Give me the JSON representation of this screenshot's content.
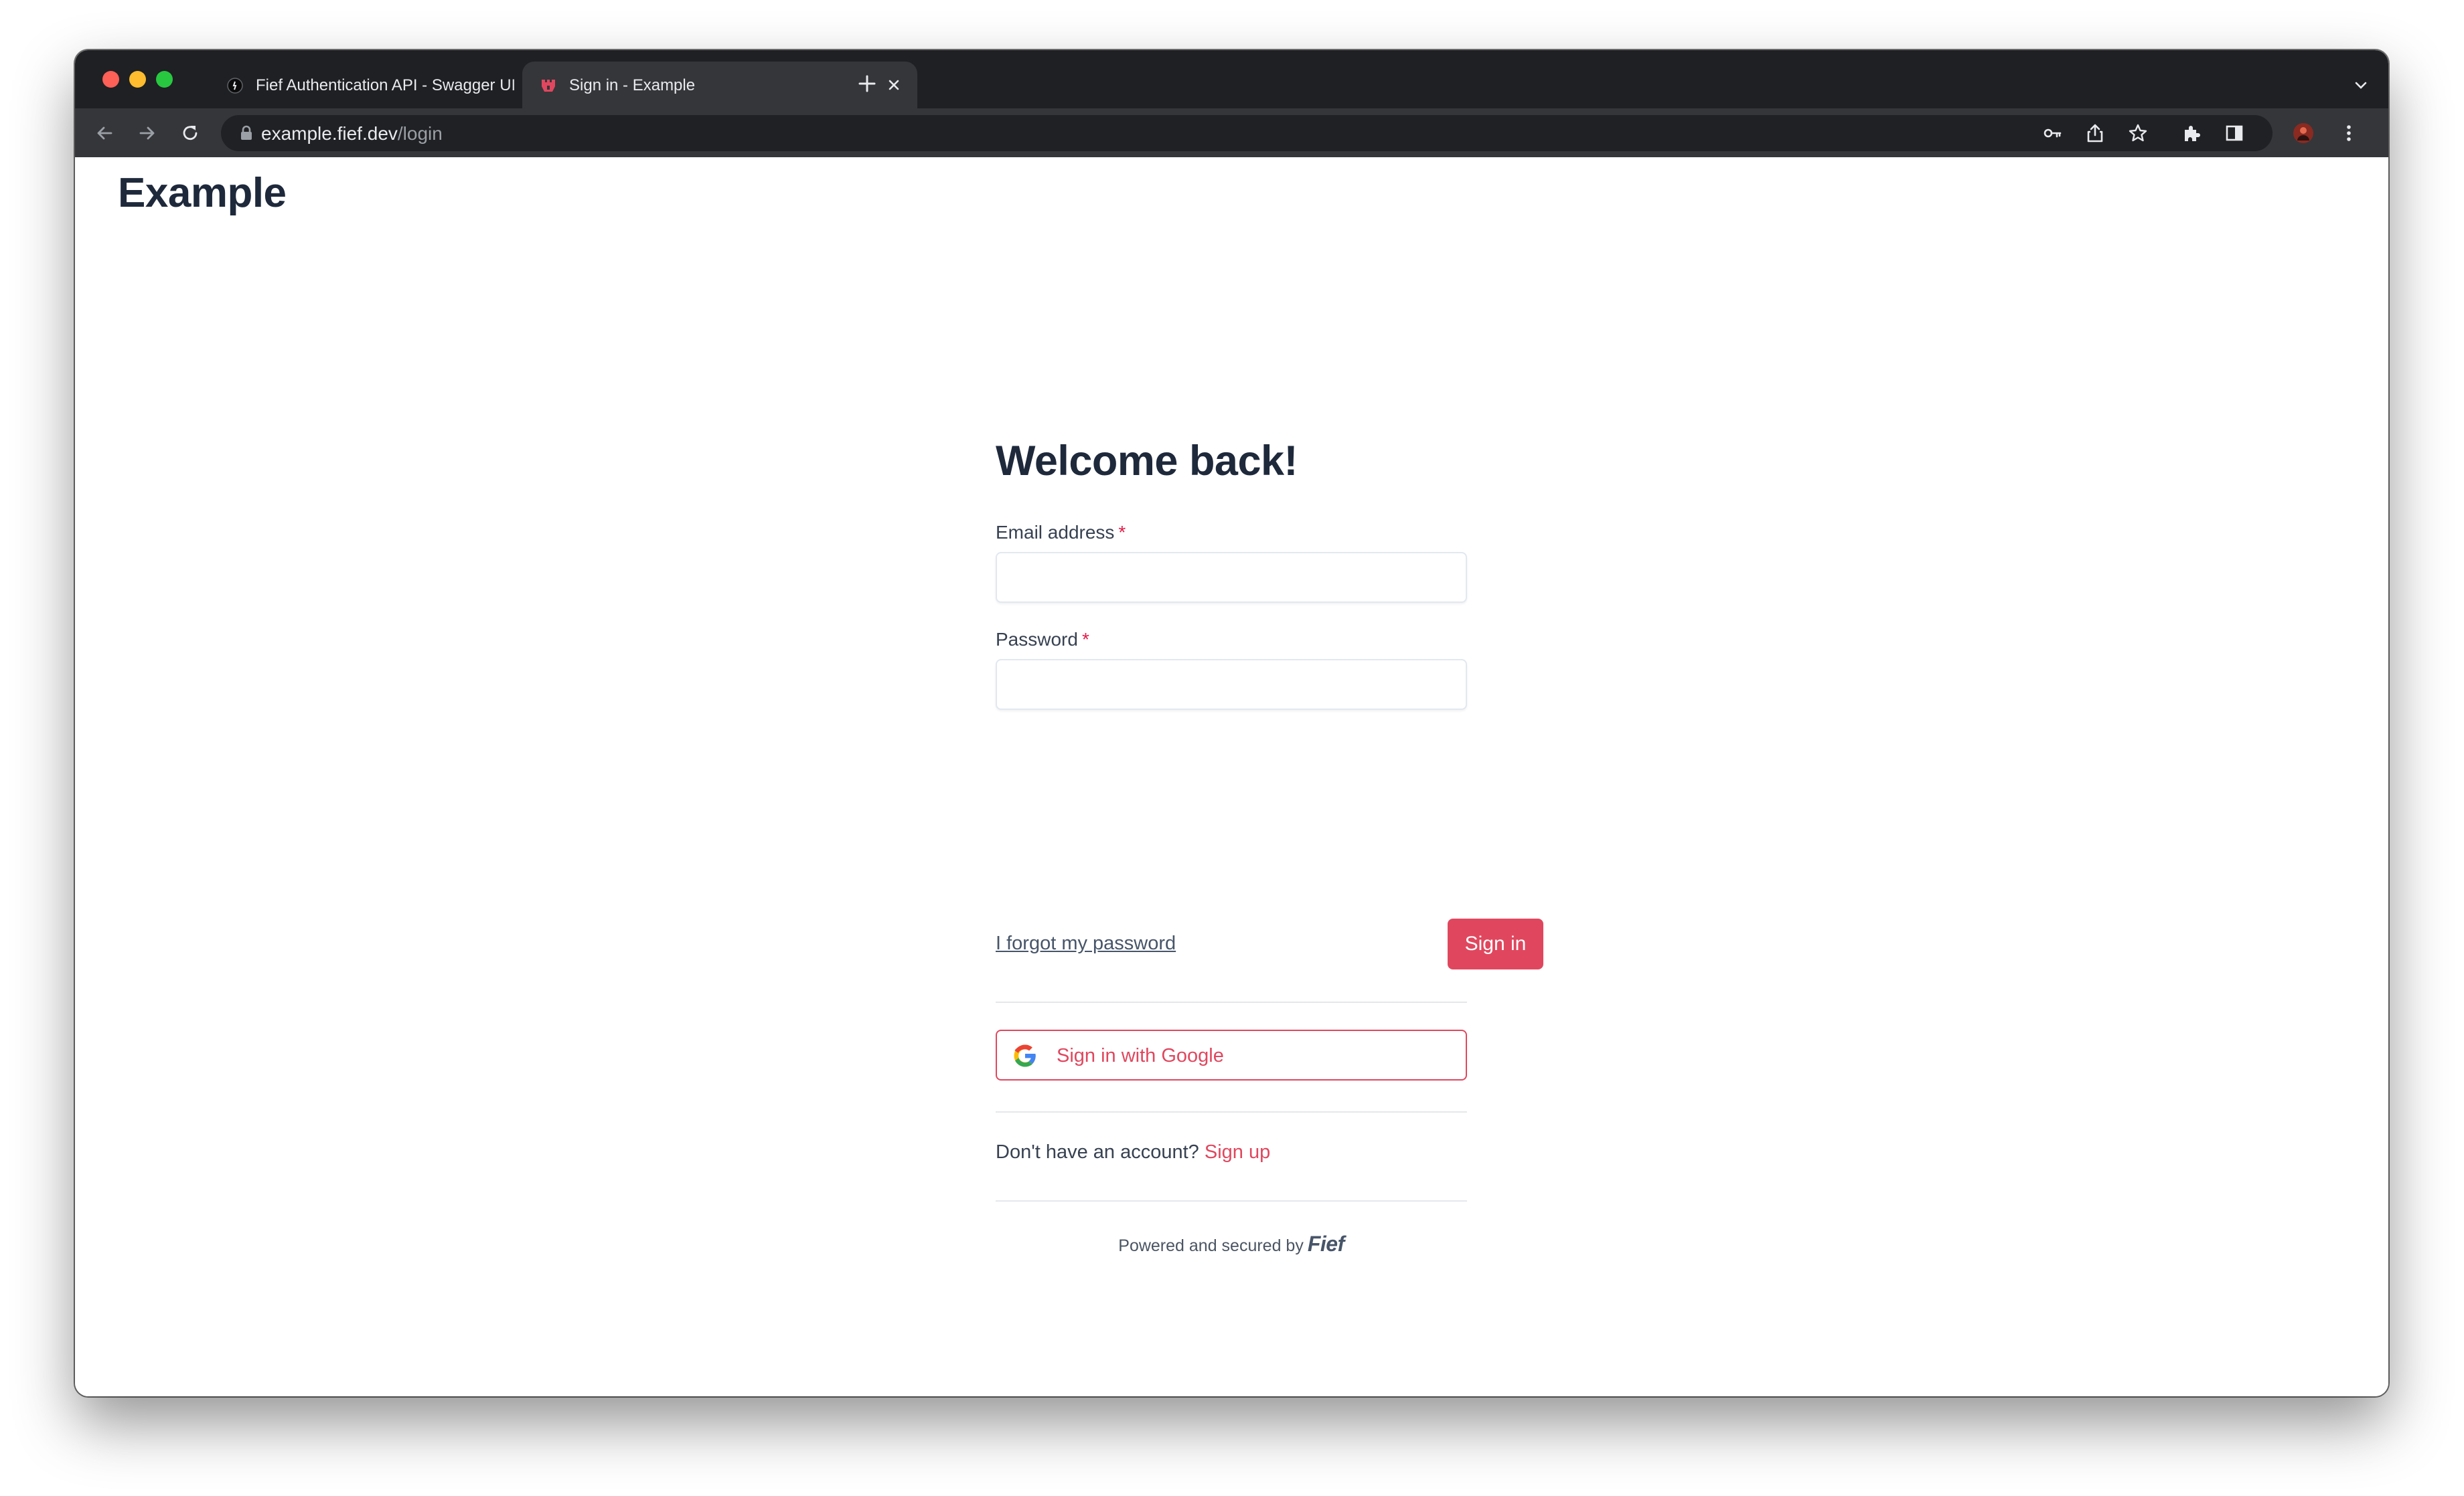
{
  "browser": {
    "tabs": [
      {
        "title": "Fief Authentication API - Swagger UI",
        "active": false
      },
      {
        "title": "Sign in - Example",
        "active": true
      }
    ],
    "address_bar": {
      "domain": "example.fief.dev",
      "path": "/login"
    }
  },
  "page": {
    "site_title": "Example",
    "heading": "Welcome back!",
    "email": {
      "label": "Email address",
      "required_marker": "*",
      "value": ""
    },
    "password": {
      "label": "Password",
      "required_marker": "*",
      "value": ""
    },
    "forgot_password": "I forgot my password",
    "sign_in_button": "Sign in",
    "google_button": "Sign in with Google",
    "signup_prompt": "Don't have an account?",
    "signup_link": "Sign up",
    "footer_text": "Powered and secured by",
    "footer_brand": "Fief"
  },
  "colors": {
    "accent": "#e0475e",
    "heading": "#1e293b",
    "chrome_dark": "#1f2023",
    "chrome_toolbar": "#35363a"
  }
}
